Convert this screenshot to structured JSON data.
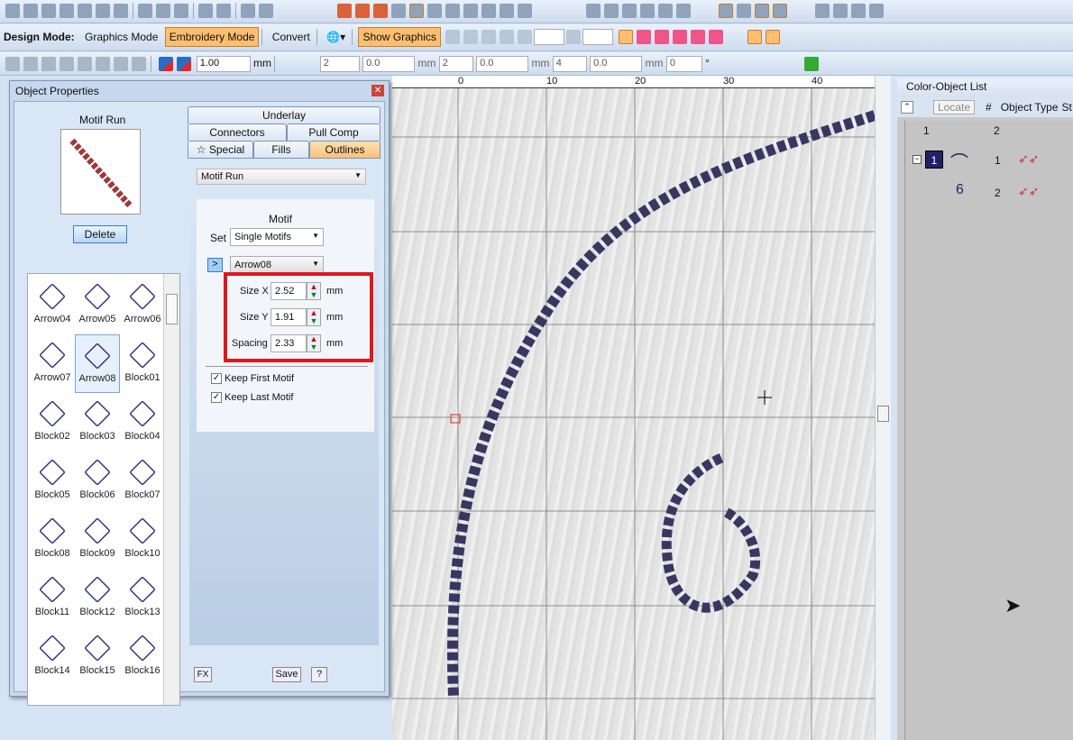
{
  "toolbar": {
    "design_mode_label": "Design Mode:",
    "graphics_mode": "Graphics Mode",
    "embroidery_mode": "Embroidery Mode",
    "convert": "Convert",
    "show_graphics": "Show Graphics",
    "width_value": "1.00",
    "unit": "mm",
    "f1": "2",
    "f2": "0.0",
    "f3": "2",
    "f4": "0.0",
    "f5": "4",
    "f6": "0.0",
    "f7": "0",
    "degree": "°"
  },
  "ruler": {
    "labels": [
      "0",
      "10",
      "20",
      "30",
      "40"
    ]
  },
  "dialog": {
    "title": "Object Properties",
    "preview_label": "Motif Run",
    "delete": "Delete",
    "tabs": {
      "underlay": "Underlay",
      "connectors": "Connectors",
      "pull_comp": "Pull Comp",
      "special": "Special",
      "fills": "Fills",
      "outlines": "Outlines"
    },
    "stitch_type": "Motif Run",
    "motif_heading": "Motif",
    "set_label": "Set",
    "set_value": "Single Motifs",
    "next_btn": ">",
    "motif_value": "Arrow08",
    "size_x_label": "Size X",
    "size_x": "2.52",
    "size_y_label": "Size Y",
    "size_y": "1.91",
    "spacing_label": "Spacing",
    "spacing": "2.33",
    "unit": "mm",
    "keep_first": "Keep First Motif",
    "keep_last": "Keep Last Motif",
    "fx": "FX",
    "save": "Save",
    "help": "?",
    "gallery": [
      "Arrow04",
      "Arrow05",
      "Arrow06",
      "Arrow07",
      "Arrow08",
      "Block01",
      "Block02",
      "Block03",
      "Block04",
      "Block05",
      "Block06",
      "Block07",
      "Block08",
      "Block09",
      "Block10",
      "Block11",
      "Block12",
      "Block13",
      "Block14",
      "Block15",
      "Block16"
    ]
  },
  "color_list": {
    "title": "Color-Object List",
    "locate": "Locate",
    "col_hash": "#",
    "col_type": "Object Type",
    "col_st": "St",
    "header_nums": [
      "1",
      "2"
    ],
    "color_num": "1",
    "rows": [
      "1",
      "2"
    ],
    "color_swatch": "#23206a"
  }
}
